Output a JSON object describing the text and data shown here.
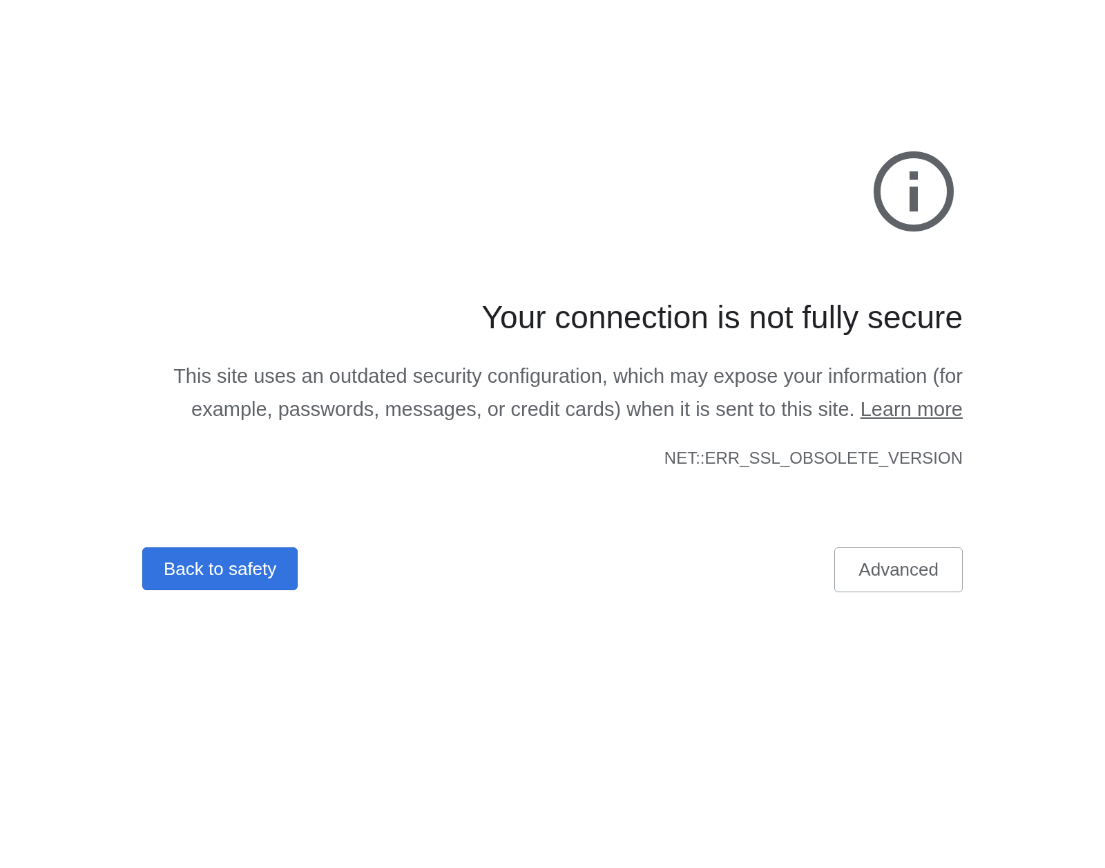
{
  "heading": "Your connection is not fully secure",
  "explanation": "This site uses an outdated security configuration, which may expose your information (for example, passwords, messages, or credit cards) when it is sent to this site.",
  "learn_more_link": "Learn more",
  "error_code": "NET::ERR_SSL_OBSOLETE_VERSION",
  "buttons": [
    {
      "label": "Back to safety",
      "kind": "primary"
    },
    {
      "label": "Advanced",
      "kind": "secondary"
    }
  ]
}
